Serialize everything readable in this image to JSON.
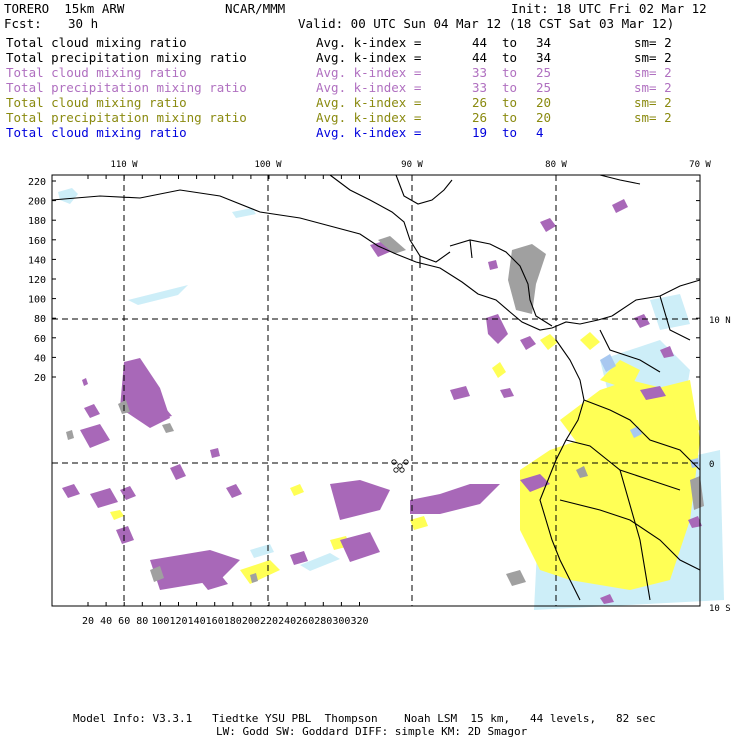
{
  "header": {
    "model": "TORERO  15km ARW",
    "org": "NCAR/MMM",
    "init": "Init: 18 UTC Fri 02 Mar 12",
    "fcst_label": "Fcst:",
    "fcst_value": "30 h",
    "valid": "Valid: 00 UTC Sun 04 Mar 12 (18 CST Sat 03 Mar 12)"
  },
  "legend": [
    {
      "field": "Total cloud mixing ratio",
      "kindex": "Avg. k-index =",
      "from": "44",
      "to_word": "to",
      "to": "34",
      "sm": "sm= 2",
      "color": "#000000"
    },
    {
      "field": "Total precipitation mixing ratio",
      "kindex": "Avg. k-index =",
      "from": "44",
      "to_word": "to",
      "to": "34",
      "sm": "sm= 2",
      "color": "#000000"
    },
    {
      "field": "Total cloud mixing ratio",
      "kindex": "Avg. k-index =",
      "from": "33",
      "to_word": "to",
      "to": "25",
      "sm": "sm= 2",
      "color": "#b070c0"
    },
    {
      "field": "Total precipitation mixing ratio",
      "kindex": "Avg. k-index =",
      "from": "33",
      "to_word": "to",
      "to": "25",
      "sm": "sm= 2",
      "color": "#b070c0"
    },
    {
      "field": "Total cloud mixing ratio",
      "kindex": "Avg. k-index =",
      "from": "26",
      "to_word": "to",
      "to": "20",
      "sm": "sm= 2",
      "color": "#8a8a10"
    },
    {
      "field": "Total precipitation mixing ratio",
      "kindex": "Avg. k-index =",
      "from": "26",
      "to_word": "to",
      "to": "20",
      "sm": "sm= 2",
      "color": "#8a8a10"
    },
    {
      "field": "Total cloud mixing ratio",
      "kindex": "Avg. k-index =",
      "from": "19",
      "to_word": "to",
      "to": "4",
      "sm": "",
      "color": "#0000dd"
    }
  ],
  "map": {
    "lon_labels": [
      "110 W",
      "100 W",
      "90 W",
      "80 W",
      "70 W"
    ],
    "lat_labels": [
      "10 N",
      "0",
      "10 S"
    ],
    "grid_x_ticks": [
      "20",
      "40",
      "60",
      "80",
      "100",
      "120",
      "140",
      "160",
      "180",
      "200",
      "220",
      "240",
      "260",
      "280",
      "300",
      "320"
    ],
    "grid_y_ticks": [
      "220",
      "200",
      "180",
      "160",
      "140",
      "120",
      "100",
      "80",
      "60",
      "40",
      "20"
    ],
    "colors": {
      "cloud_high": "#a0a0a0",
      "cloud_mid": "#a868b8",
      "cloud_low": "#ffff55",
      "cloud_light": "#cdeef8",
      "cloud_blue": "#a8c8f0"
    }
  },
  "footer": {
    "line1": "Model Info: V3.3.1   Tiedtke YSU PBL  Thompson    Noah LSM  15 km,   44 levels,   82 sec",
    "line2": "LW: Godd SW: Goddard DIFF: simple KM: 2D Smagor"
  }
}
